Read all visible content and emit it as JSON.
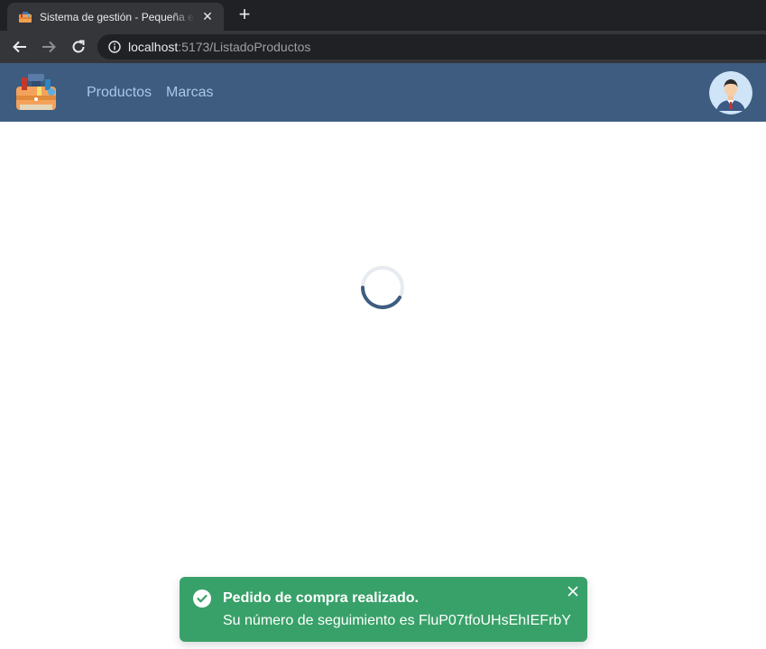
{
  "browser": {
    "tab_title": "Sistema de gestión - Pequeña empresa",
    "tab_close_icon": "close-icon",
    "new_tab_icon": "plus-icon",
    "url_host": "localhost",
    "url_path": ":5173/ListadoProductos"
  },
  "header": {
    "logo_icon": "toolbox-logo-icon",
    "nav": [
      {
        "label": "Productos"
      },
      {
        "label": "Marcas"
      }
    ],
    "avatar_icon": "user-avatar-icon"
  },
  "loading": {
    "icon": "spinner-icon"
  },
  "toast": {
    "title": "Pedido de compra realizado.",
    "description": "Su número de seguimiento es FluP07tfoUHsEhIEFrbY",
    "status_icon": "check-circle-icon",
    "close_icon": "close-icon"
  },
  "colors": {
    "header_bg": "#3d5c80",
    "nav_link": "#a8c8e8",
    "toast_bg": "#38a169",
    "spinner": "#3d5c80"
  }
}
